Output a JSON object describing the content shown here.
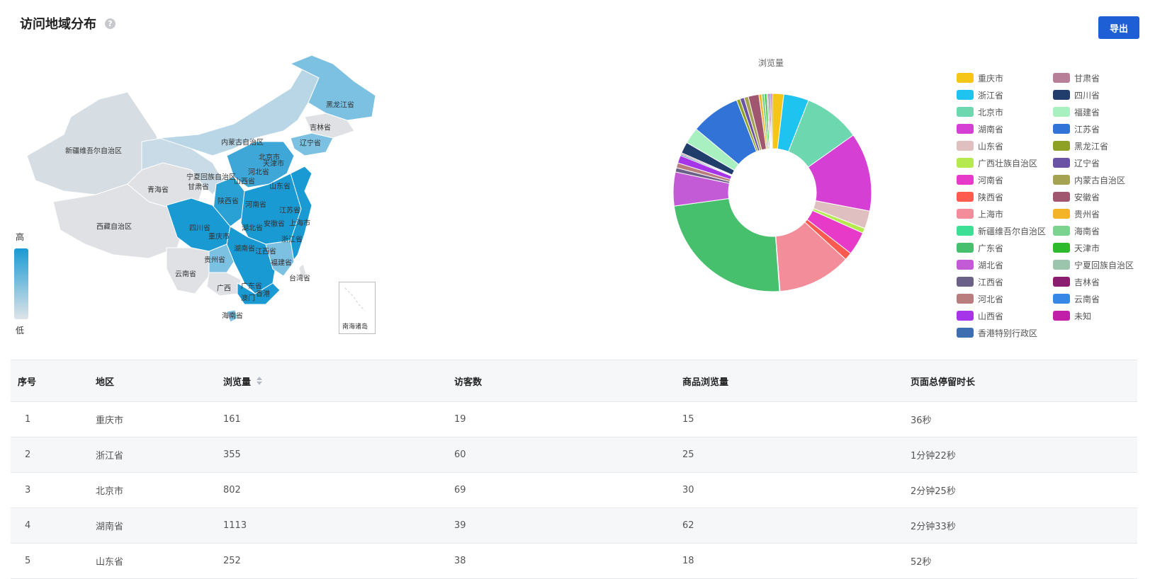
{
  "header": {
    "title": "访问地域分布",
    "help_icon": "?",
    "export_label": "导出"
  },
  "map": {
    "scale_high": "高",
    "scale_low": "低",
    "south_sea_label": "南海诸岛",
    "colors": {
      "high": "#1a9ad3",
      "mid": "#7cc1e2",
      "light": "#b8d6e6",
      "none": "#dfe1e4"
    },
    "labels": [
      "黑龙江省",
      "吉林省",
      "辽宁省",
      "内蒙古自治区",
      "新疆维吾尔自治区",
      "北京市",
      "天津市",
      "河北省",
      "宁夏回族自治区",
      "甘肃省",
      "山西省",
      "山东省",
      "青海省",
      "陕西省",
      "河南省",
      "江苏省",
      "西藏自治区",
      "四川省",
      "重庆市",
      "湖北省",
      "安徽省",
      "上海市",
      "浙江省",
      "湖南省",
      "江西省",
      "贵州省",
      "云南省",
      "福建省",
      "台湾省",
      "广西",
      "广东省",
      "香港",
      "澳门",
      "海南省"
    ]
  },
  "chart_data": {
    "type": "pie",
    "title": "浏览量",
    "categories": [
      "重庆市",
      "浙江省",
      "北京市",
      "湖南省",
      "山东省",
      "广西壮族自治区",
      "河南省",
      "陕西省",
      "上海市",
      "新疆维吾尔自治区",
      "广东省",
      "湖北省",
      "江西省",
      "河北省",
      "山西省",
      "香港特别行政区",
      "甘肃省",
      "四川省",
      "福建省",
      "江苏省",
      "黑龙江省",
      "辽宁省",
      "内蒙古自治区",
      "安徽省",
      "贵州省",
      "海南省",
      "天津市",
      "宁夏回族自治区",
      "吉林省",
      "云南省",
      "未知"
    ],
    "values": [
      161,
      355,
      802,
      1113,
      252,
      70,
      330,
      110,
      1040,
      8,
      2080,
      480,
      60,
      70,
      110,
      20,
      20,
      160,
      230,
      700,
      50,
      60,
      60,
      150,
      40,
      40,
      30,
      20,
      20,
      20,
      20
    ],
    "colors": [
      "#f5c518",
      "#1ec3f0",
      "#6dd8b0",
      "#d63fd4",
      "#e0bfc0",
      "#b5ea4f",
      "#e73ac8",
      "#ff5a4f",
      "#f28d99",
      "#3ce095",
      "#46c06c",
      "#c45bd6",
      "#6a6088",
      "#b97d7d",
      "#a635ea",
      "#3d6fb0",
      "#b87f98",
      "#203d6c",
      "#a9f0c0",
      "#3173d6",
      "#8fa124",
      "#6a52a5",
      "#a5a252",
      "#a1566f",
      "#f3b427",
      "#7bd38e",
      "#2eba2d",
      "#9cc5ae",
      "#8a1d70",
      "#3788e6",
      "#c21fa8"
    ],
    "legend_position": "right"
  },
  "table": {
    "headers": [
      "序号",
      "地区",
      "浏览量",
      "访客数",
      "商品浏览量",
      "页面总停留时长"
    ],
    "rows": [
      [
        "1",
        "重庆市",
        "161",
        "19",
        "15",
        "36秒"
      ],
      [
        "2",
        "浙江省",
        "355",
        "60",
        "25",
        "1分钟22秒"
      ],
      [
        "3",
        "北京市",
        "802",
        "69",
        "30",
        "2分钟25秒"
      ],
      [
        "4",
        "湖南省",
        "1113",
        "39",
        "62",
        "2分钟33秒"
      ],
      [
        "5",
        "山东省",
        "252",
        "38",
        "18",
        "52秒"
      ]
    ]
  }
}
